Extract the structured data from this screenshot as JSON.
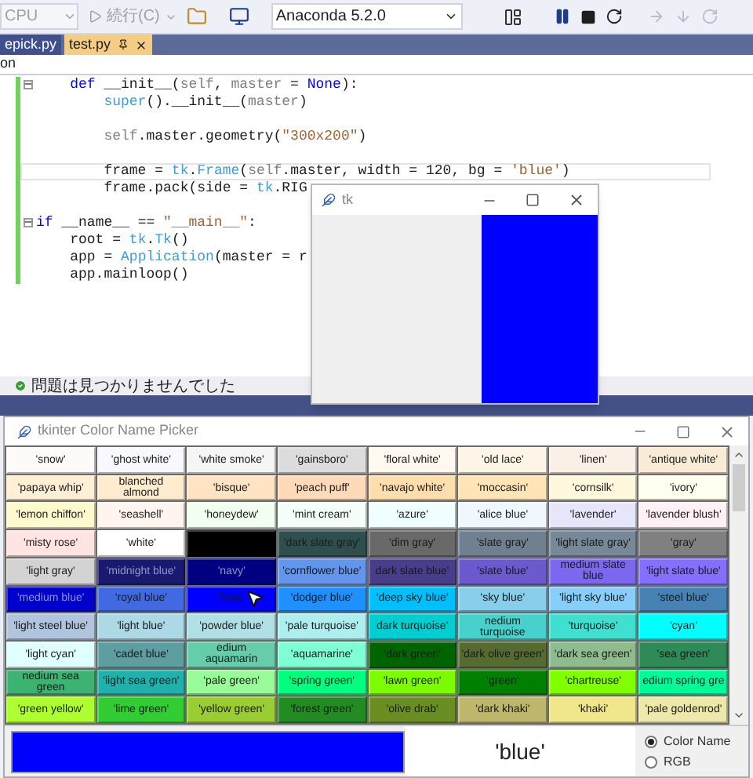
{
  "toolbar": {
    "platform": {
      "label": "CPU",
      "disabled": true
    },
    "run": {
      "label": "続行(C)",
      "disabled": true
    },
    "environment": {
      "label": "Anaconda 5.2.0"
    }
  },
  "doc_tabs": [
    {
      "label": "epick.py",
      "selected": false
    },
    {
      "label": "test.py",
      "selected": true
    }
  ],
  "breadcrumb": "on",
  "code_lines": [
    {
      "kind": "code",
      "fold": true,
      "current": false,
      "tokens": [
        {
          "t": "    def",
          "kind": "keyword"
        },
        {
          "t": " __init__(",
          "kind": "plain"
        },
        {
          "t": "self",
          "kind": "self"
        },
        {
          "t": ", ",
          "kind": "plain"
        },
        {
          "t": "master",
          "kind": "self"
        },
        {
          "t": " = ",
          "kind": "plain"
        },
        {
          "t": "None",
          "kind": "keyword"
        },
        {
          "t": "):",
          "kind": "plain"
        }
      ]
    },
    {
      "kind": "code",
      "fold": false,
      "current": false,
      "tokens": [
        {
          "t": "        super",
          "kind": "builtin"
        },
        {
          "t": "().__init__(",
          "kind": "plain"
        },
        {
          "t": "master",
          "kind": "self"
        },
        {
          "t": ")",
          "kind": "plain"
        }
      ]
    },
    {
      "kind": "blank"
    },
    {
      "kind": "code",
      "fold": false,
      "current": false,
      "tokens": [
        {
          "t": "        self",
          "kind": "self"
        },
        {
          "t": ".master.geometry(",
          "kind": "plain"
        },
        {
          "t": "\"300x200\"",
          "kind": "string"
        },
        {
          "t": ")",
          "kind": "plain"
        }
      ]
    },
    {
      "kind": "blank"
    },
    {
      "kind": "code",
      "fold": false,
      "current": true,
      "tokens": [
        {
          "t": "        frame = ",
          "kind": "plain"
        },
        {
          "t": "tk",
          "kind": "builtin"
        },
        {
          "t": ".",
          "kind": "plain"
        },
        {
          "t": "Frame",
          "kind": "builtin"
        },
        {
          "t": "(",
          "kind": "plain"
        },
        {
          "t": "self",
          "kind": "self"
        },
        {
          "t": ".master, width = 120, bg = ",
          "kind": "plain"
        },
        {
          "t": "'blue'",
          "kind": "string"
        },
        {
          "t": ")",
          "kind": "plain"
        }
      ]
    },
    {
      "kind": "code",
      "fold": false,
      "current": false,
      "tokens": [
        {
          "t": "        frame.pack(side = ",
          "kind": "plain"
        },
        {
          "t": "tk",
          "kind": "builtin"
        },
        {
          "t": ".RIG",
          "kind": "plain"
        }
      ]
    },
    {
      "kind": "blank"
    },
    {
      "kind": "code",
      "fold": true,
      "current": false,
      "tokens": [
        {
          "t": "if",
          "kind": "keyword"
        },
        {
          "t": " __name__ == ",
          "kind": "plain"
        },
        {
          "t": "\"__main__\"",
          "kind": "string"
        },
        {
          "t": ":",
          "kind": "plain"
        }
      ]
    },
    {
      "kind": "code",
      "fold": false,
      "current": false,
      "tokens": [
        {
          "t": "    root = ",
          "kind": "plain"
        },
        {
          "t": "tk",
          "kind": "builtin"
        },
        {
          "t": ".",
          "kind": "plain"
        },
        {
          "t": "Tk",
          "kind": "builtin"
        },
        {
          "t": "()",
          "kind": "plain"
        }
      ]
    },
    {
      "kind": "code",
      "fold": false,
      "current": false,
      "tokens": [
        {
          "t": "    app = ",
          "kind": "plain"
        },
        {
          "t": "Application",
          "kind": "builtin"
        },
        {
          "t": "(master = r",
          "kind": "plain"
        }
      ]
    },
    {
      "kind": "code",
      "fold": false,
      "current": false,
      "tokens": [
        {
          "t": "    app.mainloop()",
          "kind": "plain"
        }
      ]
    }
  ],
  "status": "問題は見つかりませんでした",
  "tk_window": {
    "title": "tk"
  },
  "picker": {
    "title": "tkinter Color Name Picker",
    "rows": [
      {
        "cells": [
          {
            "label": "'snow'",
            "color": "#fffafa"
          },
          {
            "label": "'ghost white'",
            "color": "#f8f8ff"
          },
          {
            "label": "'white smoke'",
            "color": "#f5f5f5"
          },
          {
            "label": "'gainsboro'",
            "color": "#dcdcdc"
          },
          {
            "label": "'floral white'",
            "color": "#fffaf0"
          },
          {
            "label": "'old lace'",
            "color": "#fdf5e6"
          },
          {
            "label": "'linen'",
            "color": "#faf0e6"
          },
          {
            "label": "'antique white'",
            "color": "#faebd7"
          }
        ]
      },
      {
        "cells": [
          {
            "label": "'papaya whip'",
            "color": "#ffefd5"
          },
          {
            "label": "blanched almond",
            "color": "#ffebcd"
          },
          {
            "label": "'bisque'",
            "color": "#ffe4c4"
          },
          {
            "label": "'peach puff'",
            "color": "#ffdab9"
          },
          {
            "label": "'navajo white'",
            "color": "#ffdead"
          },
          {
            "label": "'moccasin'",
            "color": "#ffe4b5"
          },
          {
            "label": "'cornsilk'",
            "color": "#fff8dc"
          },
          {
            "label": "'ivory'",
            "color": "#fffff0"
          }
        ]
      },
      {
        "cells": [
          {
            "label": "'lemon chiffon'",
            "color": "#fffacd"
          },
          {
            "label": "'seashell'",
            "color": "#fff5ee"
          },
          {
            "label": "'honeydew'",
            "color": "#f0fff0"
          },
          {
            "label": "'mint cream'",
            "color": "#f5fffa"
          },
          {
            "label": "'azure'",
            "color": "#f0ffff"
          },
          {
            "label": "'alice blue'",
            "color": "#f0f8ff"
          },
          {
            "label": "'lavender'",
            "color": "#e6e6fa"
          },
          {
            "label": "'lavender blush'",
            "color": "#fff0f5"
          }
        ]
      },
      {
        "cells": [
          {
            "label": "'misty rose'",
            "color": "#ffe4e1"
          },
          {
            "label": "'white'",
            "color": "#ffffff"
          },
          {
            "color": "#000000"
          },
          {
            "label": "'dark slate gray'",
            "color": "#2f4f4f"
          },
          {
            "label": "'dim gray'",
            "color": "#696969"
          },
          {
            "label": "'slate gray'",
            "color": "#708090"
          },
          {
            "label": "'light slate gray'",
            "color": "#778899"
          },
          {
            "label": "'gray'",
            "color": "#808080"
          }
        ]
      },
      {
        "cells": [
          {
            "label": "'light gray'",
            "color": "#d3d3d3"
          },
          {
            "label": "'midnight blue'",
            "color": "#191970"
          },
          {
            "label": "'navy'",
            "color": "#000080"
          },
          {
            "label": "'cornflower blue'",
            "color": "#6495ed"
          },
          {
            "label": "dark slate blue'",
            "color": "#483d8b"
          },
          {
            "label": "'slate blue'",
            "color": "#6a5acd"
          },
          {
            "label": "medium slate blue",
            "color": "#7b68ee"
          },
          {
            "label": "'light slate blue'",
            "color": "#8470ff"
          }
        ]
      },
      {
        "cells": [
          {
            "label": "'medium blue'",
            "color": "#0000cd"
          },
          {
            "label": "'royal blue'",
            "color": "#4169e1"
          },
          {
            "label": "'blue'",
            "color": "#0000ff"
          },
          {
            "label": "'dodger blue'",
            "color": "#1e90ff"
          },
          {
            "label": "'deep sky blue'",
            "color": "#00bfff"
          },
          {
            "label": "'sky blue'",
            "color": "#87ceeb"
          },
          {
            "label": "'light sky blue'",
            "color": "#87cefa"
          },
          {
            "label": "'steel blue'",
            "color": "#4682b4"
          }
        ]
      },
      {
        "cells": [
          {
            "label": "'light steel blue'",
            "color": "#b0c4de"
          },
          {
            "label": "'light blue'",
            "color": "#add8e6"
          },
          {
            "label": "'powder blue'",
            "color": "#b0e0e6"
          },
          {
            "label": "'pale turquoise'",
            "color": "#afeeee"
          },
          {
            "label": "dark turquoise'",
            "color": "#00ced1"
          },
          {
            "label": "nedium turquoise",
            "color": "#48d1cc"
          },
          {
            "label": "'turquoise'",
            "color": "#40e0d0"
          },
          {
            "label": "'cyan'",
            "color": "#00ffff"
          }
        ]
      },
      {
        "cells": [
          {
            "label": "'light cyan'",
            "color": "#e0ffff"
          },
          {
            "label": "'cadet blue'",
            "color": "#5f9ea0"
          },
          {
            "label": "edium aquamarin",
            "color": "#66cdaa"
          },
          {
            "label": "'aquamarine'",
            "color": "#7fffd4"
          },
          {
            "label": "'dark green'",
            "color": "#006400"
          },
          {
            "label": "'dark olive green'",
            "color": "#556b2f"
          },
          {
            "label": "'dark sea green'",
            "color": "#8fbc8f"
          },
          {
            "label": "'sea green'",
            "color": "#2e8b57"
          }
        ]
      },
      {
        "cells": [
          {
            "label": "nedium sea green",
            "color": "#3cb371"
          },
          {
            "label": "'light sea green'",
            "color": "#20b2aa"
          },
          {
            "label": "'pale green'",
            "color": "#98fb98"
          },
          {
            "label": "'spring green'",
            "color": "#00ff7f"
          },
          {
            "label": "'lawn green'",
            "color": "#7cfc00"
          },
          {
            "label": "'green'",
            "color": "#008000"
          },
          {
            "label": "'chartreuse'",
            "color": "#7fff00"
          },
          {
            "label": "edium spring gre",
            "color": "#00fa9a"
          }
        ]
      },
      {
        "cells": [
          {
            "label": "'green yellow'",
            "color": "#adff2f"
          },
          {
            "label": "'lime green'",
            "color": "#32cd32"
          },
          {
            "label": "'yellow green'",
            "color": "#9acd32"
          },
          {
            "label": "'forest green'",
            "color": "#228b22"
          },
          {
            "label": "'olive drab'",
            "color": "#6b8e23"
          },
          {
            "label": "'dark khaki'",
            "color": "#bdb76b"
          },
          {
            "label": "'khaki'",
            "color": "#f0e68c"
          },
          {
            "label": "'pale goldenrod'",
            "color": "#eee8aa"
          }
        ]
      }
    ],
    "chosen_name": "'blue'",
    "modes": [
      {
        "label": "Color Name",
        "selected": true
      },
      {
        "label": "RGB",
        "selected": false
      }
    ]
  }
}
